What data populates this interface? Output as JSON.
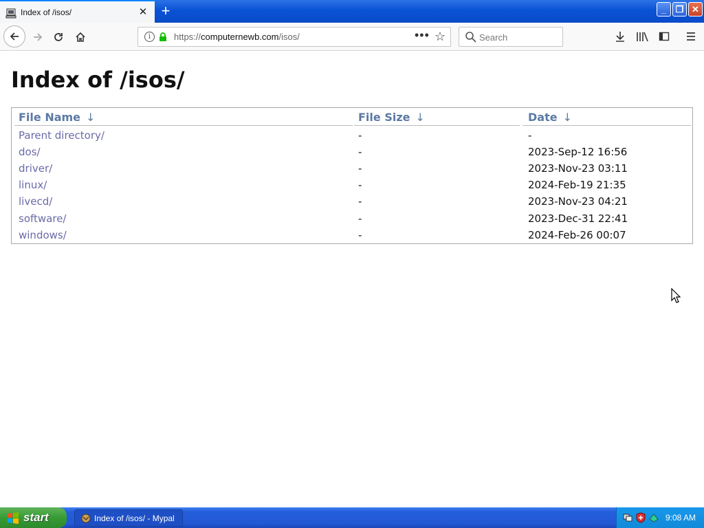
{
  "browser": {
    "tab_title": "Index of /isos/",
    "tab_close": "✕",
    "new_tab": "+",
    "window_controls": {
      "minimize": "_",
      "restore": "❐",
      "close": "✕"
    },
    "url_prefix": "https://",
    "url_domain": "computernewb.com",
    "url_path": "/isos/",
    "search_placeholder": "Search",
    "page_actions": "•••",
    "bookmark_star": "☆",
    "icons": [
      "back-icon",
      "forward-icon",
      "reload-icon",
      "home-icon",
      "info-icon",
      "lock-icon",
      "search-icon",
      "download-icon",
      "library-icon",
      "sidebar-icon",
      "menu-icon"
    ]
  },
  "page": {
    "heading": "Index of /isos/",
    "columns": {
      "name": "File Name",
      "size": "File Size",
      "date": "Date",
      "sort_arrow": "↓"
    },
    "rows": [
      {
        "name": "Parent directory/",
        "size": "-",
        "date": "-"
      },
      {
        "name": "dos/",
        "size": "-",
        "date": "2023-Sep-12 16:56"
      },
      {
        "name": "driver/",
        "size": "-",
        "date": "2023-Nov-23 03:11"
      },
      {
        "name": "linux/",
        "size": "-",
        "date": "2024-Feb-19 21:35"
      },
      {
        "name": "livecd/",
        "size": "-",
        "date": "2023-Nov-23 04:21"
      },
      {
        "name": "software/",
        "size": "-",
        "date": "2023-Dec-31 22:41"
      },
      {
        "name": "windows/",
        "size": "-",
        "date": "2024-Feb-26 00:07"
      }
    ],
    "link_color": "#6a6aa8",
    "header_color": "#5b7aa5"
  },
  "taskbar": {
    "start_label": "start",
    "task_label": "Index of /isos/ - Mypal",
    "clock": "9:08 AM"
  }
}
